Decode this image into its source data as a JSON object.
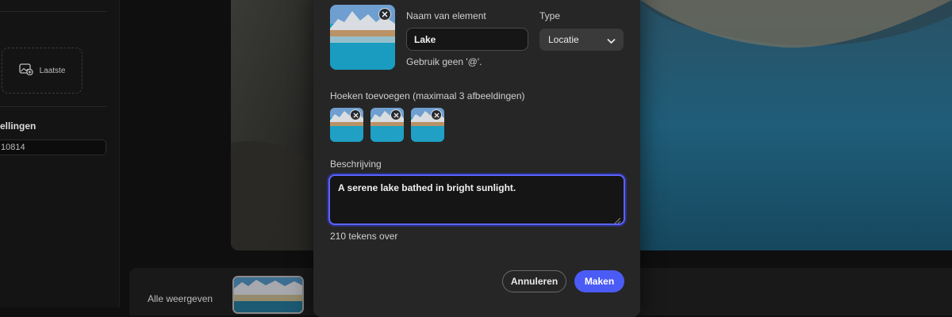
{
  "sidebar": {
    "upload_label": "Laatste",
    "heading": "ellingen",
    "field_value": "10814"
  },
  "bottom": {
    "show_all_label": "Alle weergeven"
  },
  "modal": {
    "name_label": "Naam van element",
    "name_value": "Lake",
    "type_label": "Type",
    "type_value": "Locatie",
    "name_hint": "Gebruik geen '@'.",
    "angles_label": "Hoeken toevoegen (maximaal 3 afbeeldingen)",
    "description_label": "Beschrijving",
    "description_value": "A serene lake bathed in bright sunlight.",
    "char_counter": "210 tekens over",
    "cancel_label": "Annuleren",
    "create_label": "Maken",
    "accent_color": "#4b5bf5"
  }
}
